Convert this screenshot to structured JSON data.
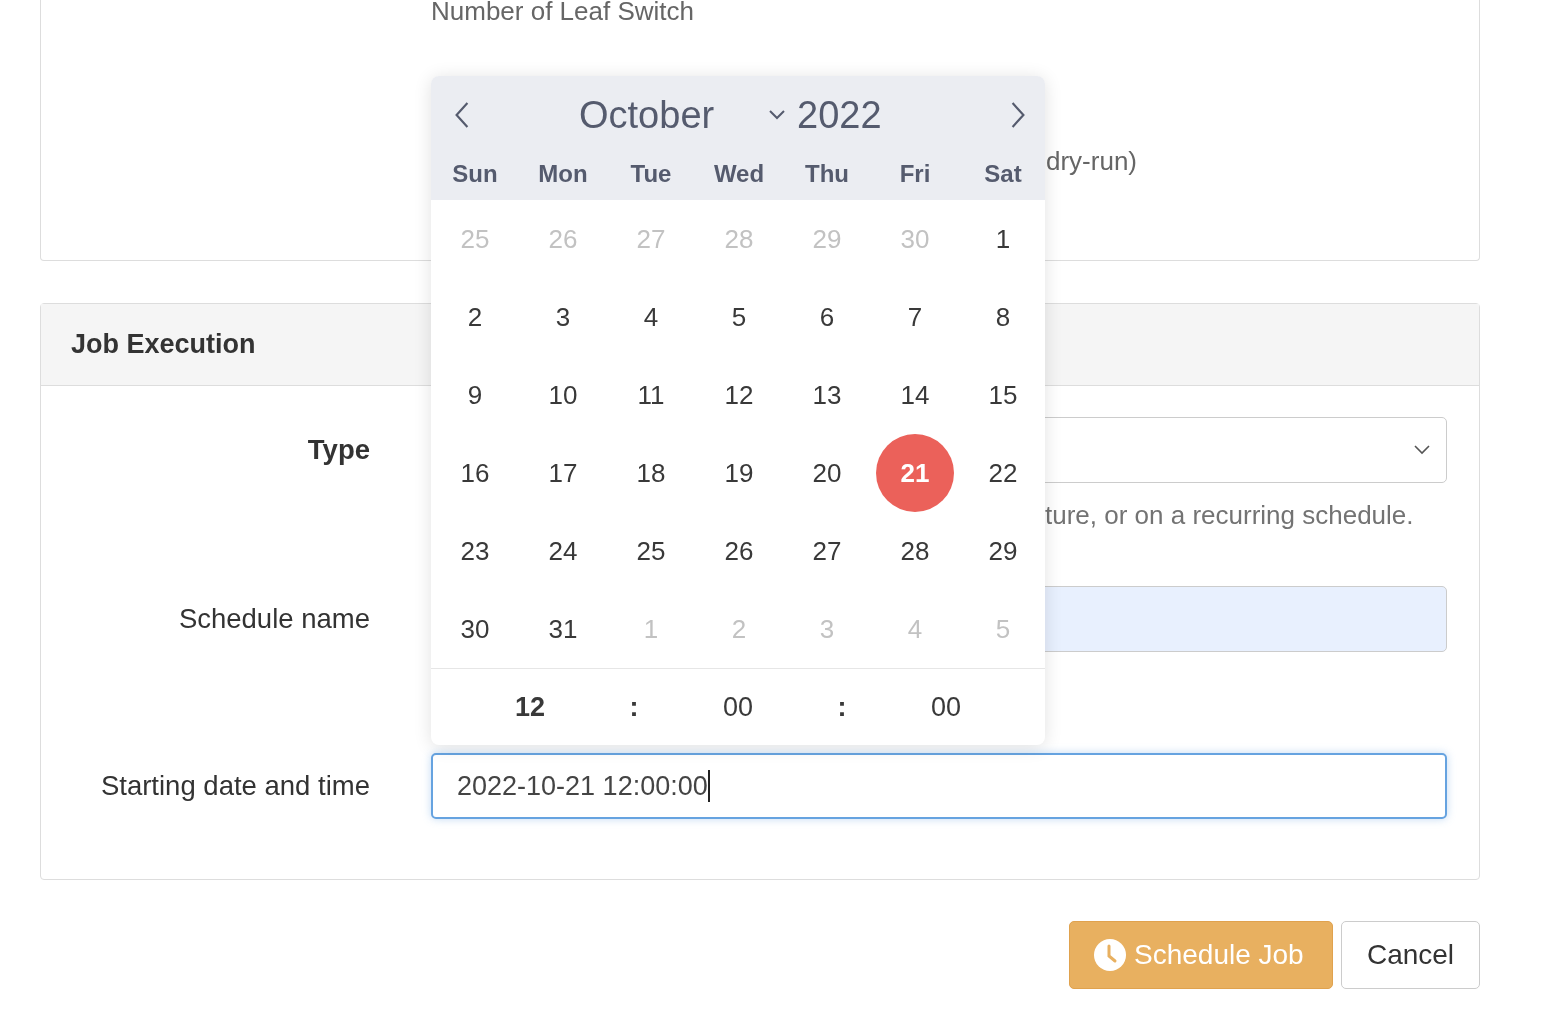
{
  "top_card": {
    "field_label": "Number of Leaf Switch",
    "note": "dry-run)"
  },
  "job_execution": {
    "title": "Job Execution",
    "fields": [
      {
        "kind": "select",
        "label": "Type",
        "help": "ture, or on a recurring schedule."
      },
      {
        "kind": "text",
        "label": "Schedule name",
        "autofilled": true
      },
      {
        "kind": "datetime",
        "label": "Starting date and time",
        "value": "2022-10-21 12:00:00",
        "focused": true
      }
    ]
  },
  "calendar": {
    "month": "October",
    "year": "2022",
    "weekdays": [
      "Sun",
      "Mon",
      "Tue",
      "Wed",
      "Thu",
      "Fri",
      "Sat"
    ],
    "days": [
      {
        "day": "25",
        "muted": true,
        "selected": false
      },
      {
        "day": "26",
        "muted": true,
        "selected": false
      },
      {
        "day": "27",
        "muted": true,
        "selected": false
      },
      {
        "day": "28",
        "muted": true,
        "selected": false
      },
      {
        "day": "29",
        "muted": true,
        "selected": false
      },
      {
        "day": "30",
        "muted": true,
        "selected": false
      },
      {
        "day": "1",
        "muted": false,
        "selected": false
      },
      {
        "day": "2",
        "muted": false,
        "selected": false
      },
      {
        "day": "3",
        "muted": false,
        "selected": false
      },
      {
        "day": "4",
        "muted": false,
        "selected": false
      },
      {
        "day": "5",
        "muted": false,
        "selected": false
      },
      {
        "day": "6",
        "muted": false,
        "selected": false
      },
      {
        "day": "7",
        "muted": false,
        "selected": false
      },
      {
        "day": "8",
        "muted": false,
        "selected": false
      },
      {
        "day": "9",
        "muted": false,
        "selected": false
      },
      {
        "day": "10",
        "muted": false,
        "selected": false
      },
      {
        "day": "11",
        "muted": false,
        "selected": false
      },
      {
        "day": "12",
        "muted": false,
        "selected": false
      },
      {
        "day": "13",
        "muted": false,
        "selected": false
      },
      {
        "day": "14",
        "muted": false,
        "selected": false
      },
      {
        "day": "15",
        "muted": false,
        "selected": false
      },
      {
        "day": "16",
        "muted": false,
        "selected": false
      },
      {
        "day": "17",
        "muted": false,
        "selected": false
      },
      {
        "day": "18",
        "muted": false,
        "selected": false
      },
      {
        "day": "19",
        "muted": false,
        "selected": false
      },
      {
        "day": "20",
        "muted": false,
        "selected": false
      },
      {
        "day": "21",
        "muted": false,
        "selected": true
      },
      {
        "day": "22",
        "muted": false,
        "selected": false
      },
      {
        "day": "23",
        "muted": false,
        "selected": false
      },
      {
        "day": "24",
        "muted": false,
        "selected": false
      },
      {
        "day": "25",
        "muted": false,
        "selected": false
      },
      {
        "day": "26",
        "muted": false,
        "selected": false
      },
      {
        "day": "27",
        "muted": false,
        "selected": false
      },
      {
        "day": "28",
        "muted": false,
        "selected": false
      },
      {
        "day": "29",
        "muted": false,
        "selected": false
      },
      {
        "day": "30",
        "muted": false,
        "selected": false
      },
      {
        "day": "31",
        "muted": false,
        "selected": false
      },
      {
        "day": "1",
        "muted": true,
        "selected": false
      },
      {
        "day": "2",
        "muted": true,
        "selected": false
      },
      {
        "day": "3",
        "muted": true,
        "selected": false
      },
      {
        "day": "4",
        "muted": true,
        "selected": false
      },
      {
        "day": "5",
        "muted": true,
        "selected": false
      }
    ],
    "time": [
      {
        "kind": "value",
        "text": "12",
        "active": true
      },
      {
        "kind": "separator",
        "text": ":"
      },
      {
        "kind": "value",
        "text": "00",
        "active": false
      },
      {
        "kind": "separator",
        "text": ":"
      },
      {
        "kind": "value",
        "text": "00",
        "active": false
      }
    ]
  },
  "buttons": [
    {
      "kind": "primary",
      "label": "Schedule Job"
    },
    {
      "kind": "default",
      "label": "Cancel"
    }
  ]
}
